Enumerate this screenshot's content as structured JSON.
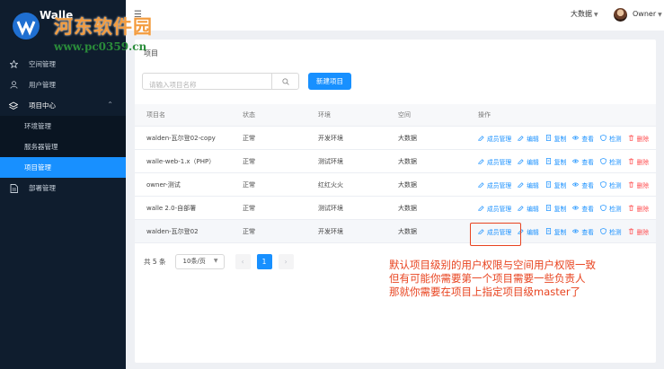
{
  "app": {
    "name": "Walle"
  },
  "sidebar": {
    "items": [
      {
        "label": "空间管理",
        "icon": "star-icon"
      },
      {
        "label": "用户管理",
        "icon": "user-icon"
      },
      {
        "label": "项目中心",
        "icon": "layers-icon"
      },
      {
        "label": "环境管理"
      },
      {
        "label": "服务器管理"
      },
      {
        "label": "项目管理"
      },
      {
        "label": "部署管理",
        "icon": "document-icon"
      }
    ]
  },
  "topbar": {
    "workspace": "大数据",
    "user": "Owner"
  },
  "main": {
    "breadcrumb": "项目",
    "search_placeholder": "请输入项目名称",
    "new_button": "新建项目",
    "columns": [
      "项目名",
      "状态",
      "环境",
      "空间",
      "操作"
    ],
    "rows": [
      {
        "name": "walden-瓦尔登02-copy",
        "status": "正常",
        "env": "开发环境",
        "space": "大数据"
      },
      {
        "name": "walle-web-1.x（PHP）",
        "status": "正常",
        "env": "测试环境",
        "space": "大数据"
      },
      {
        "name": "owner-测试",
        "status": "正常",
        "env": "红红火火",
        "space": "大数据"
      },
      {
        "name": "walle 2.0-自部署",
        "status": "正常",
        "env": "测试环境",
        "space": "大数据"
      },
      {
        "name": "walden-瓦尔登02",
        "status": "正常",
        "env": "开发环境",
        "space": "大数据"
      }
    ],
    "ops": {
      "members": "成员管理",
      "edit": "编辑",
      "copy": "复制",
      "view": "查看",
      "check": "检测",
      "delete": "删除"
    },
    "pager": {
      "total": "共 5 条",
      "size": "10条/页",
      "current": "1"
    }
  },
  "annotation": {
    "line1": "默认项目级别的用户权限与空间用户权限一致",
    "line2": "但有可能你需要第一个项目需要一些负责人",
    "line3": "那就你需要在项目上指定项目级master了"
  },
  "watermark": {
    "title": "河东软件园",
    "url": "www.pc0359.cn"
  },
  "colors": {
    "sidebar": "#0f1d2e",
    "accent": "#1890ff",
    "danger": "#ff4d4f",
    "annotation": "#e8431f"
  }
}
